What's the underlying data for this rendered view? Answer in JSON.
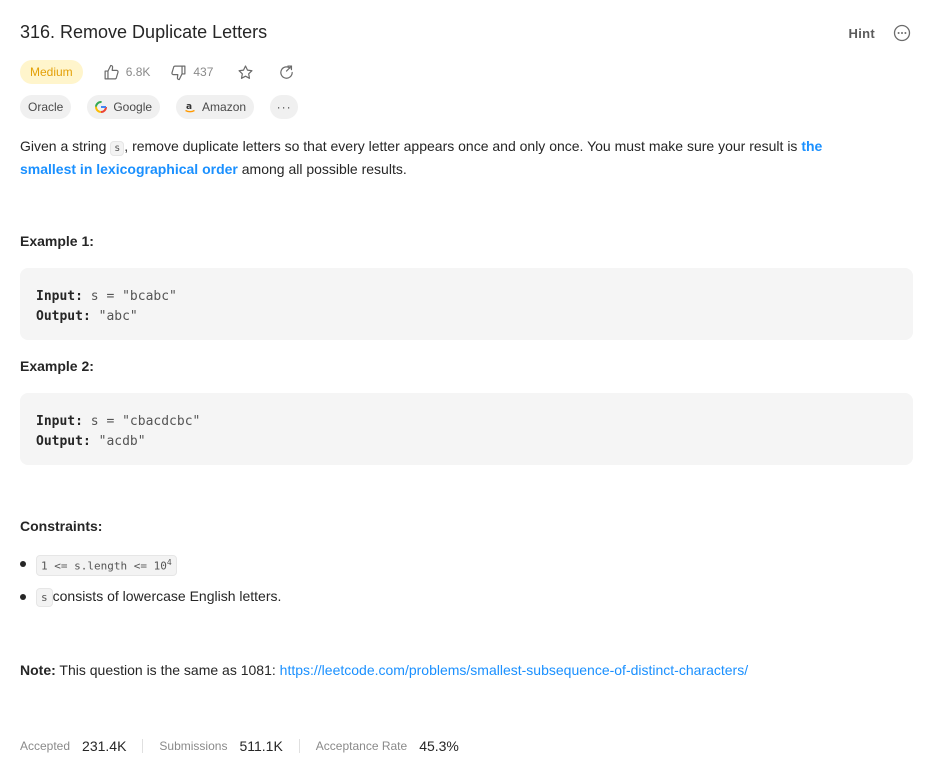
{
  "problem": {
    "title": "316. Remove Duplicate Letters",
    "difficulty": "Medium",
    "likes": "6.8K",
    "dislikes": "437"
  },
  "header": {
    "hint_label": "Hint"
  },
  "tags": {
    "items": [
      "Oracle",
      "Google",
      "Amazon"
    ],
    "more": "···"
  },
  "description": {
    "part1": "Given a string ",
    "code_s": "s",
    "part2": ", remove duplicate letters so that every letter appears once and only once. You must make sure your result is ",
    "bold": "the smallest in lexicographical order",
    "part3": " among all possible results."
  },
  "examples": [
    {
      "title": "Example 1:",
      "input_label": "Input:",
      "input_value": " s = \"bcabc\"",
      "output_label": "Output:",
      "output_value": " \"abc\""
    },
    {
      "title": "Example 2:",
      "input_label": "Input:",
      "input_value": " s = \"cbacdcbc\"",
      "output_label": "Output:",
      "output_value": " \"acdb\""
    }
  ],
  "constraints": {
    "title": "Constraints:",
    "c1_code": "1 <= s.length <= 10",
    "c1_sup": "4",
    "c2_code": "s",
    "c2_text": " consists of lowercase English letters."
  },
  "note": {
    "label": "Note:",
    "text": " This question is the same as 1081: ",
    "link": "https://leetcode.com/problems/smallest-subsequence-of-distinct-characters/"
  },
  "stats": {
    "accepted_label": "Accepted",
    "accepted": "231.4K",
    "submissions_label": "Submissions",
    "submissions": "511.1K",
    "rate_label": "Acceptance Rate",
    "rate": "45.3%"
  },
  "colors": {
    "accent": "#1a90ff",
    "medium": "#e3a008",
    "medium_bg": "#fff5cc"
  }
}
